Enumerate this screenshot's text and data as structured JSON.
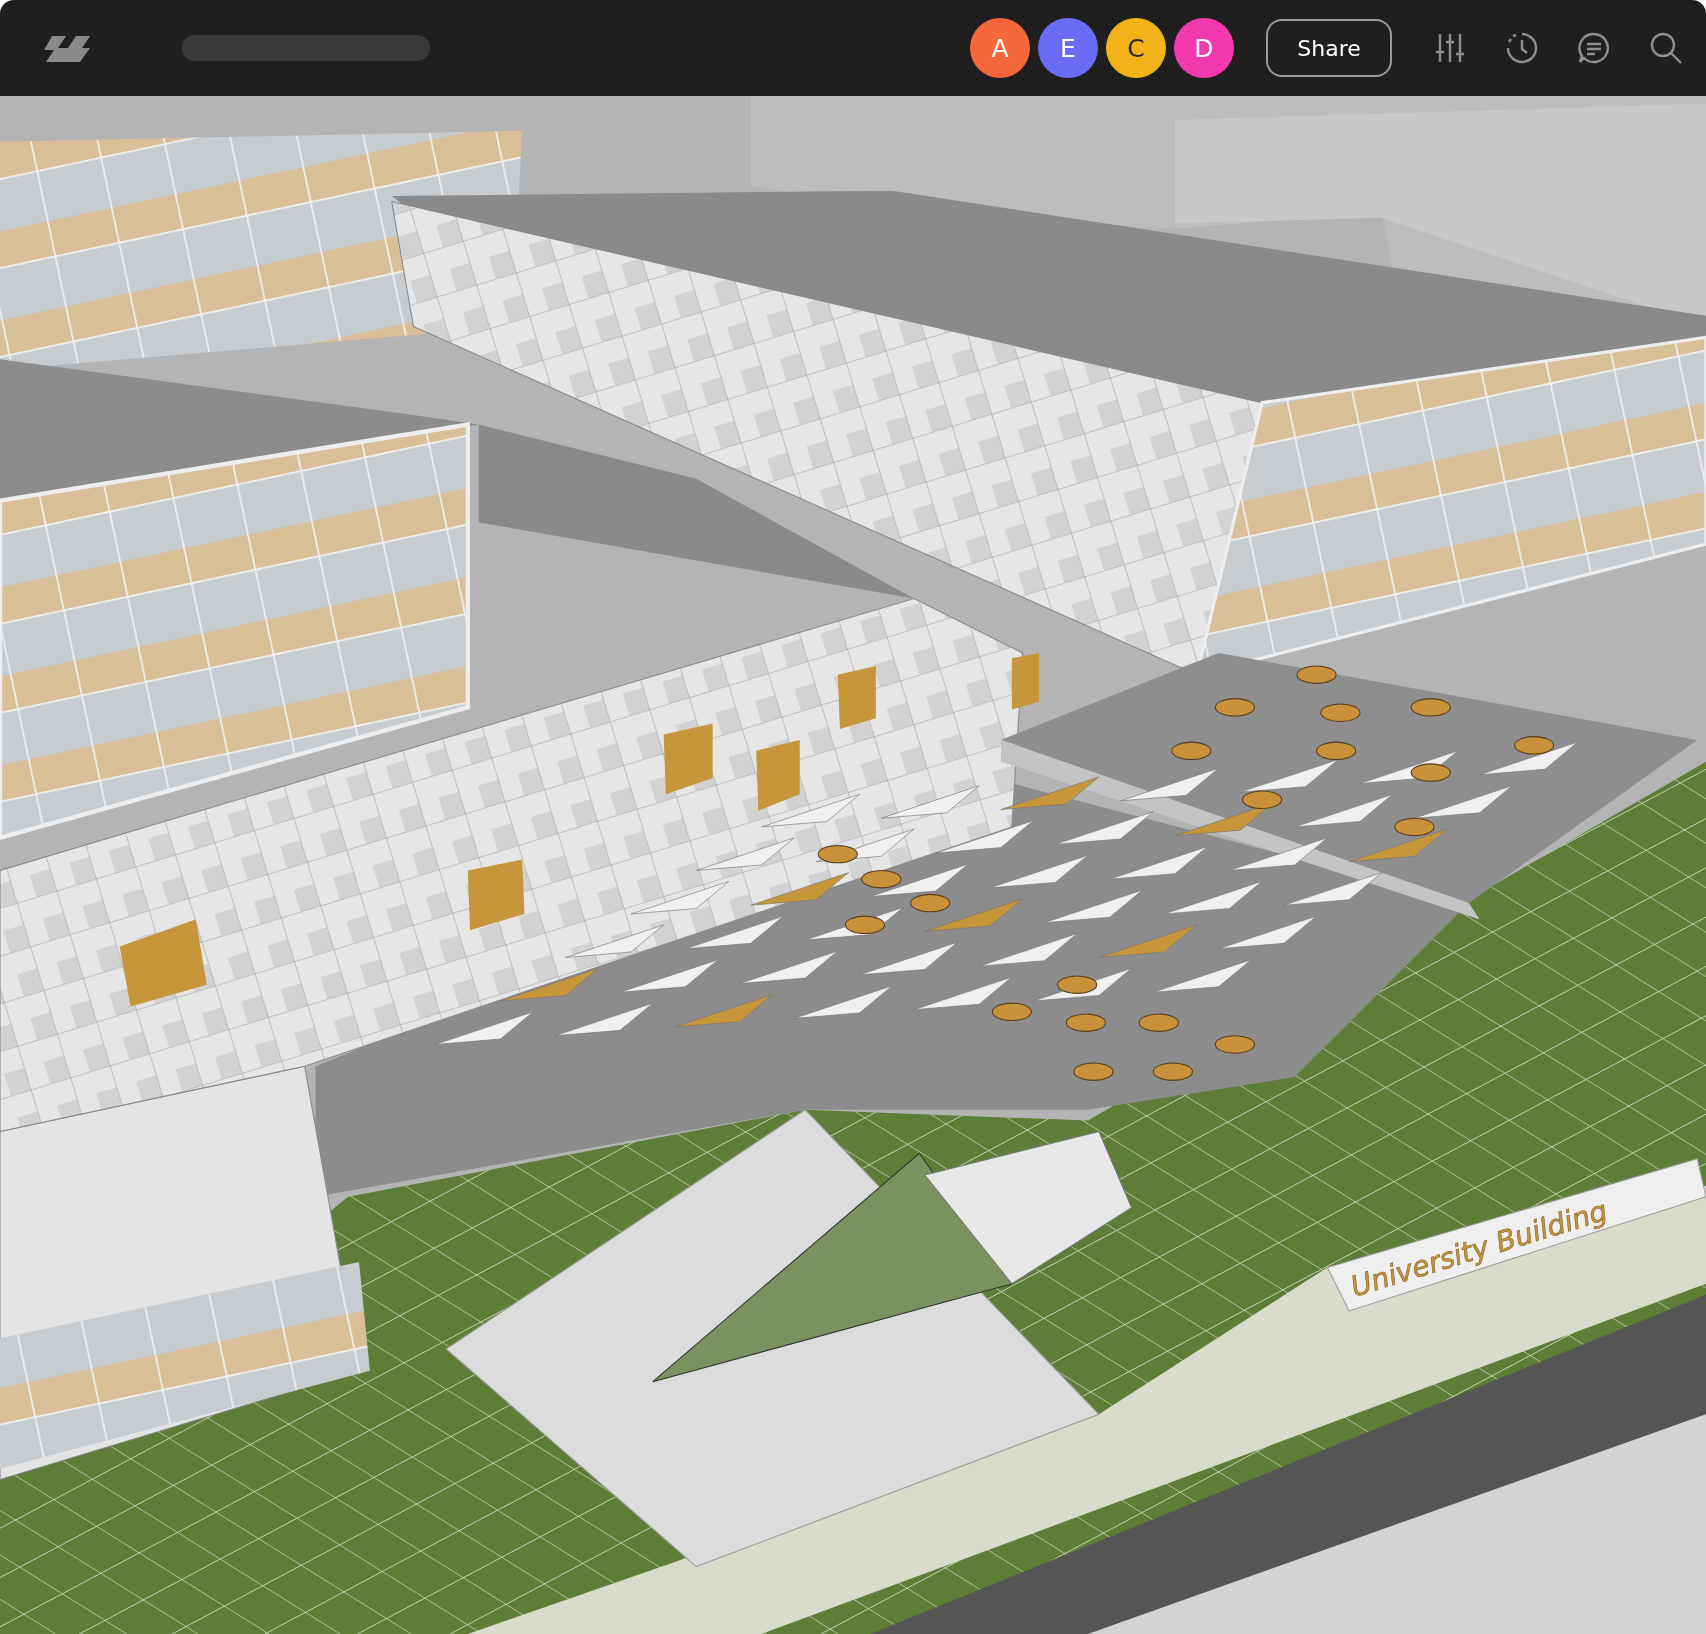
{
  "toolbar": {
    "avatars": [
      {
        "letter": "A",
        "color": "#f4683c"
      },
      {
        "letter": "E",
        "color": "#6b6cf6"
      },
      {
        "letter": "C",
        "color": "#f2b31a"
      },
      {
        "letter": "D",
        "color": "#f23ab0"
      }
    ],
    "share": "Share"
  },
  "viewport": {
    "sign_text": "University Building"
  }
}
